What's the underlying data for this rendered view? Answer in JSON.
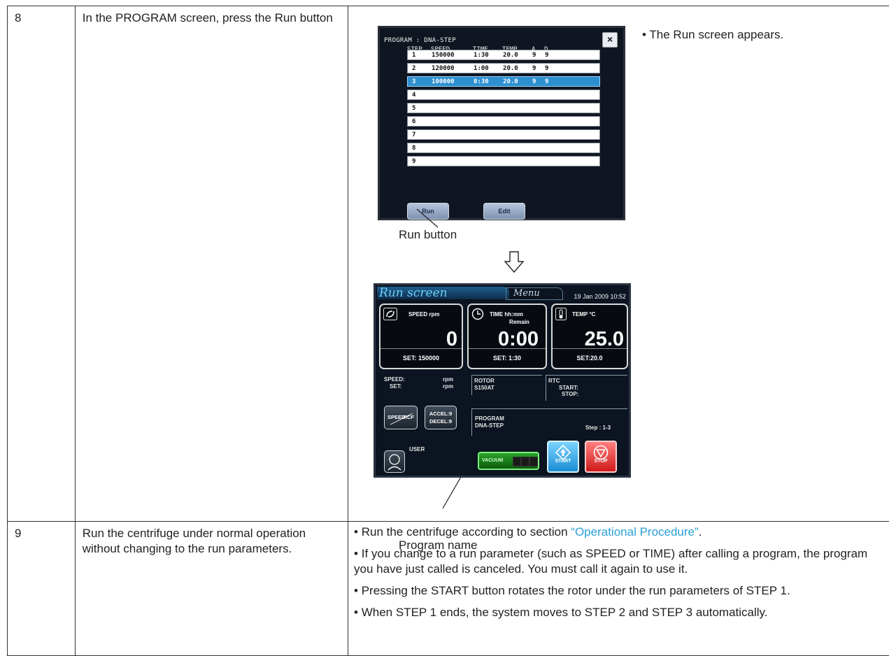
{
  "rows": [
    {
      "step": "8",
      "instruction": "In the PROGRAM screen, press the Run button",
      "note": "• The Run screen appears.",
      "callout_run": "Run button",
      "callout_program": "Program name"
    },
    {
      "step": "9",
      "instruction": "Run the centrifuge under normal operation without changing to the run parameters.",
      "note1_pre": "• Run the centrifuge according to section ",
      "note1_link": "“Operational Procedure”",
      "note1_post": ".",
      "note2": "• If you change to a run parameter (such as SPEED or TIME) after calling a program, the program you have just called is canceled. You must call it again to use it.",
      "note3": "• Pressing the START button rotates the rotor under the run parameters of STEP 1.",
      "note4": "• When STEP 1 ends, the system moves to STEP 2 and STEP 3 automatically."
    }
  ],
  "program_screen": {
    "header": "PROGRAM    : DNA-STEP",
    "columns": [
      "STEP",
      "SPEED",
      "TIME",
      "TEMP",
      "A",
      "D"
    ],
    "close": "×",
    "steps": [
      {
        "step": "1",
        "speed": "150000",
        "time": "1:30",
        "temp": "20.0",
        "a": "9",
        "d": "9"
      },
      {
        "step": "2",
        "speed": "120000",
        "time": "1:00",
        "temp": "20.0",
        "a": "9",
        "d": "9"
      },
      {
        "step": "3",
        "speed": "100000",
        "time": "0:30",
        "temp": "20.0",
        "a": "9",
        "d": "9"
      },
      {
        "step": "4"
      },
      {
        "step": "5"
      },
      {
        "step": "6"
      },
      {
        "step": "7"
      },
      {
        "step": "8"
      },
      {
        "step": "9"
      }
    ],
    "selected_step": 3,
    "run_label": "Run",
    "edit_label": "Edit"
  },
  "run_screen": {
    "title": "Run screen",
    "menu": "Menu",
    "datetime": "19 Jan 2009 10:52",
    "speed_label": "SPEED   rpm",
    "speed_value": "0",
    "speed_set": "SET:  150000",
    "time_label": "TIME   hh:mm",
    "time_remain": "Remain",
    "time_value": "0:00",
    "time_set": "SET:  1:30",
    "temp_label": "TEMP    °C",
    "temp_value": "25.0",
    "temp_set": "SET:20.0",
    "speed_read": "SPEED:",
    "speed_read_set": "SET:",
    "rpm": "rpm",
    "rotor_label": "ROTOR",
    "rotor_value": "S150AT",
    "rtc_label": "RTC",
    "rtc_start": "START:",
    "rtc_stop": "STOP:",
    "speed_btn_top": "SPEED",
    "speed_btn_bottom": "RCF",
    "accel": "ACCEL:9",
    "decel": "DECEL:9",
    "program_label": "PROGRAM",
    "program_value": "DNA-STEP",
    "step_info": "Step : 1-3",
    "user": "USER",
    "vacuum": "VACUUM",
    "start": "START",
    "stop": "STOP"
  },
  "colors": {
    "link": "#2a9fd6",
    "selected_row": "#2d8fd0",
    "start_button": "#1b8ed3",
    "stop_button": "#cf1b1b",
    "vacuum_button": "#2aa22a"
  }
}
